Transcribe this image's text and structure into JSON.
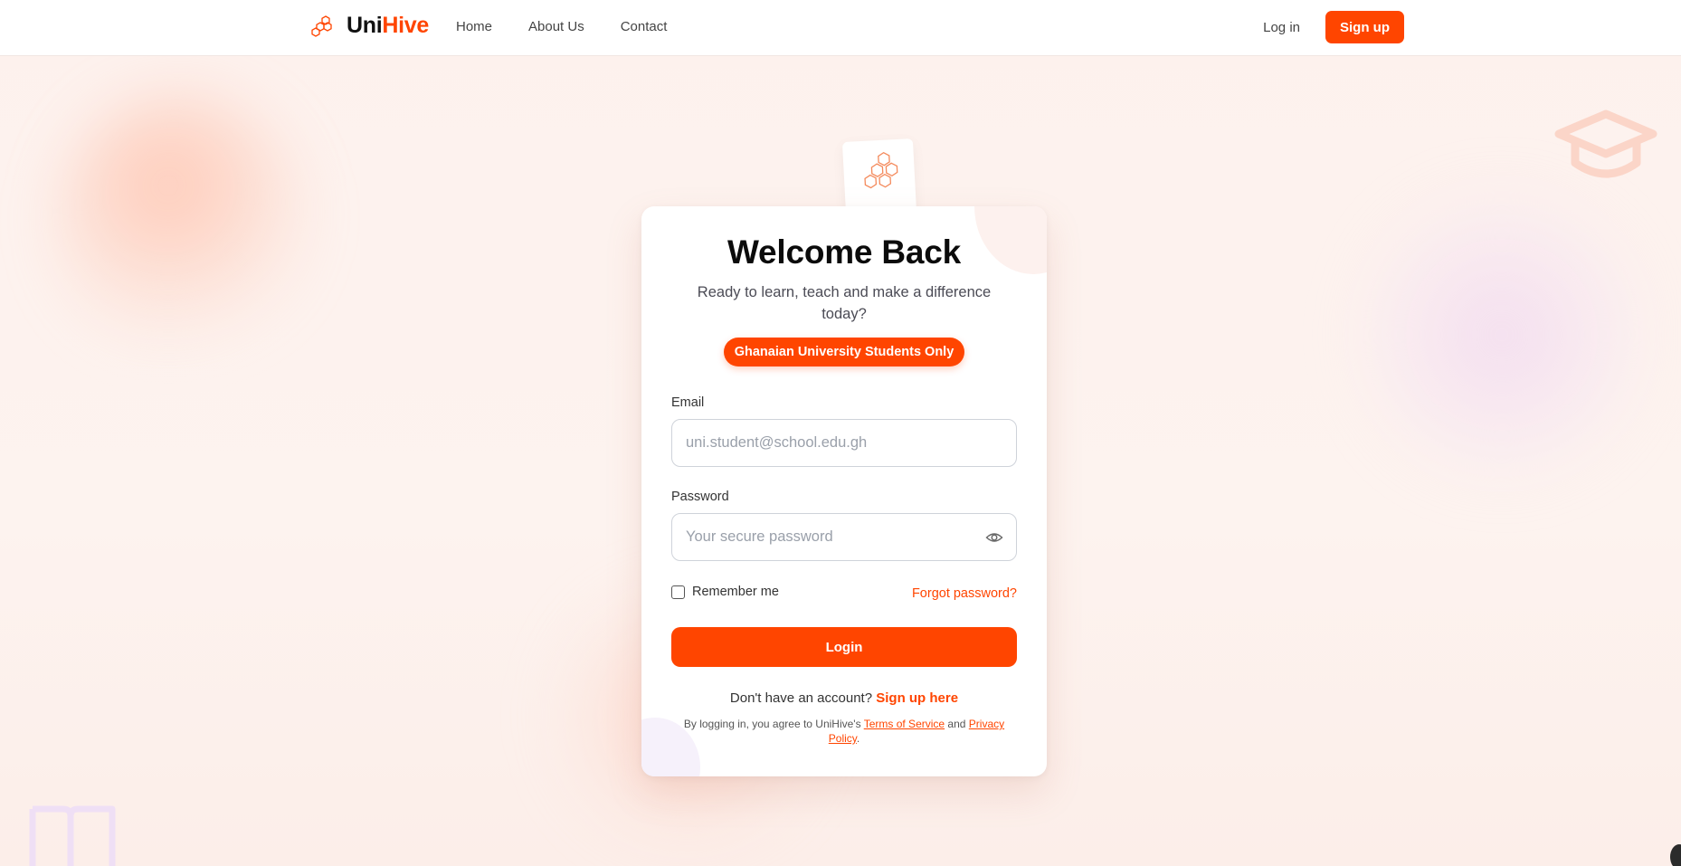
{
  "brand": {
    "name_part1": "Uni",
    "name_part2": "Hive"
  },
  "nav": {
    "links": [
      "Home",
      "About Us",
      "Contact"
    ],
    "login": "Log in",
    "signup": "Sign up"
  },
  "card": {
    "title": "Welcome Back",
    "subtitle": "Ready to learn, teach and make a difference today?",
    "badge": "Ghanaian University Students Only",
    "email_label": "Email",
    "email_placeholder": "uni.student@school.edu.gh",
    "password_label": "Password",
    "password_placeholder": "Your secure password",
    "remember": "Remember me",
    "forgot": "Forgot password?",
    "login_button": "Login",
    "no_account": "Don't have an account?",
    "signup_link": "Sign up here",
    "terms_prefix": "By logging in, you agree to UniHive's",
    "terms_of_service": "Terms of Service",
    "terms_and": "and",
    "privacy_policy": "Privacy Policy",
    "terms_suffix": "."
  },
  "colors": {
    "accent": "#ff4500",
    "background": "#fdf1ed"
  },
  "icons": [
    "hexagon-logo-icon",
    "eye-icon",
    "graduation-cap-icon",
    "book-icon"
  ]
}
